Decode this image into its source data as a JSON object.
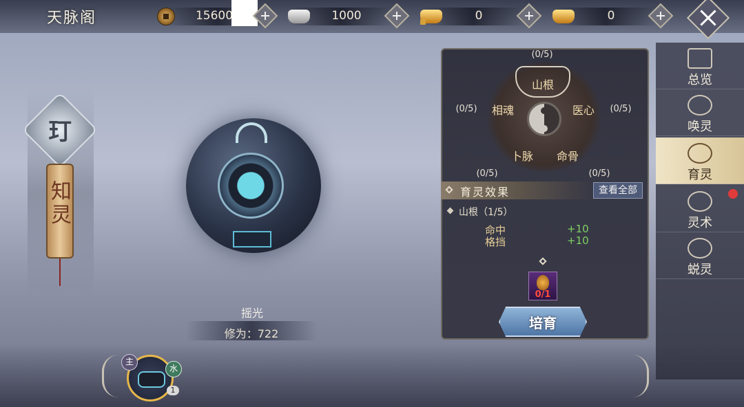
{
  "header": {
    "title": "天脉阁",
    "currencies": [
      {
        "icon": "copper-coin-icon",
        "value": "15600"
      },
      {
        "icon": "silver-ingot-icon",
        "value": "1000"
      },
      {
        "icon": "locked-gold-ingot-icon",
        "value": "0"
      },
      {
        "icon": "gold-ingot-icon",
        "value": "0"
      }
    ]
  },
  "left": {
    "emblem_glyph": "玎",
    "scroll_label": "知灵"
  },
  "spirit": {
    "name": "摇光",
    "cultivation": "修为：722"
  },
  "wheel": {
    "nodes": {
      "top": {
        "label": "山根",
        "count": "(0/5)"
      },
      "left": {
        "label": "相魂",
        "count": "(0/5)"
      },
      "right": {
        "label": "医心",
        "count": "(0/5)"
      },
      "bottom_left": {
        "label": "卜脉",
        "count": "(0/5)"
      },
      "bottom_right": {
        "label": "命骨",
        "count": "(0/5)"
      }
    }
  },
  "effect": {
    "title": "育灵效果",
    "view_all": "查看全部",
    "section": "山根（1/5）",
    "stats": [
      {
        "name": "命中",
        "value": "+10"
      },
      {
        "name": "格挡",
        "value": "+10"
      }
    ],
    "item_count": "0/1",
    "foster_button": "培育"
  },
  "tabs": [
    {
      "label": "总览",
      "active": false
    },
    {
      "label": "唤灵",
      "active": false
    },
    {
      "label": "育灵",
      "active": true
    },
    {
      "label": "灵术",
      "active": false,
      "notification": true
    },
    {
      "label": "蜕灵",
      "active": false
    }
  ],
  "bottom": {
    "main_badge": "主",
    "element_badge": "水",
    "level": "1"
  },
  "colors": {
    "stat_value": "#7ed162",
    "notification": "#e13b3b",
    "active_tab": "#efe4c6"
  }
}
